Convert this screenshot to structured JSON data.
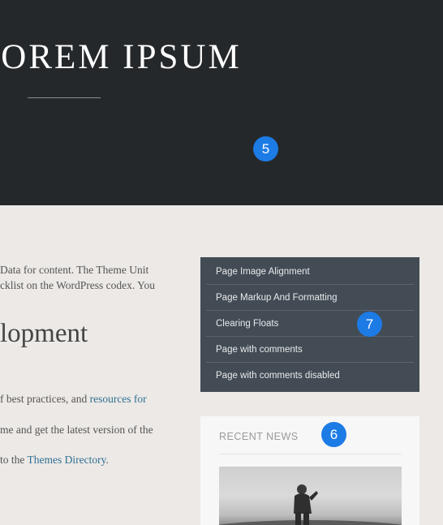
{
  "hero": {
    "title": "LOREM IPSUM",
    "marker": "5"
  },
  "content": {
    "paragraph_1": [
      "Data for content. The Theme Unit",
      "cklist on the WordPress codex. You"
    ],
    "heading": "lopment",
    "line_a_text": "f best practices, and ",
    "line_a_link": "resources for",
    "line_b_text": "me and get the latest version of the",
    "line_c_text": " to the ",
    "line_c_link": "Themes Directory",
    "line_c_end": "."
  },
  "sidebar_menu": {
    "marker": "7",
    "items": [
      "Page Image Alignment",
      "Page Markup And Formatting",
      "Clearing Floats",
      "Page with comments",
      "Page with comments disabled"
    ]
  },
  "recent_news": {
    "title": "RECENT NEWS",
    "marker": "6"
  },
  "colors": {
    "hero_bg": "#25282b",
    "menu_bg": "#434c55",
    "link": "#2f6f92",
    "marker": "#1d7be6"
  }
}
